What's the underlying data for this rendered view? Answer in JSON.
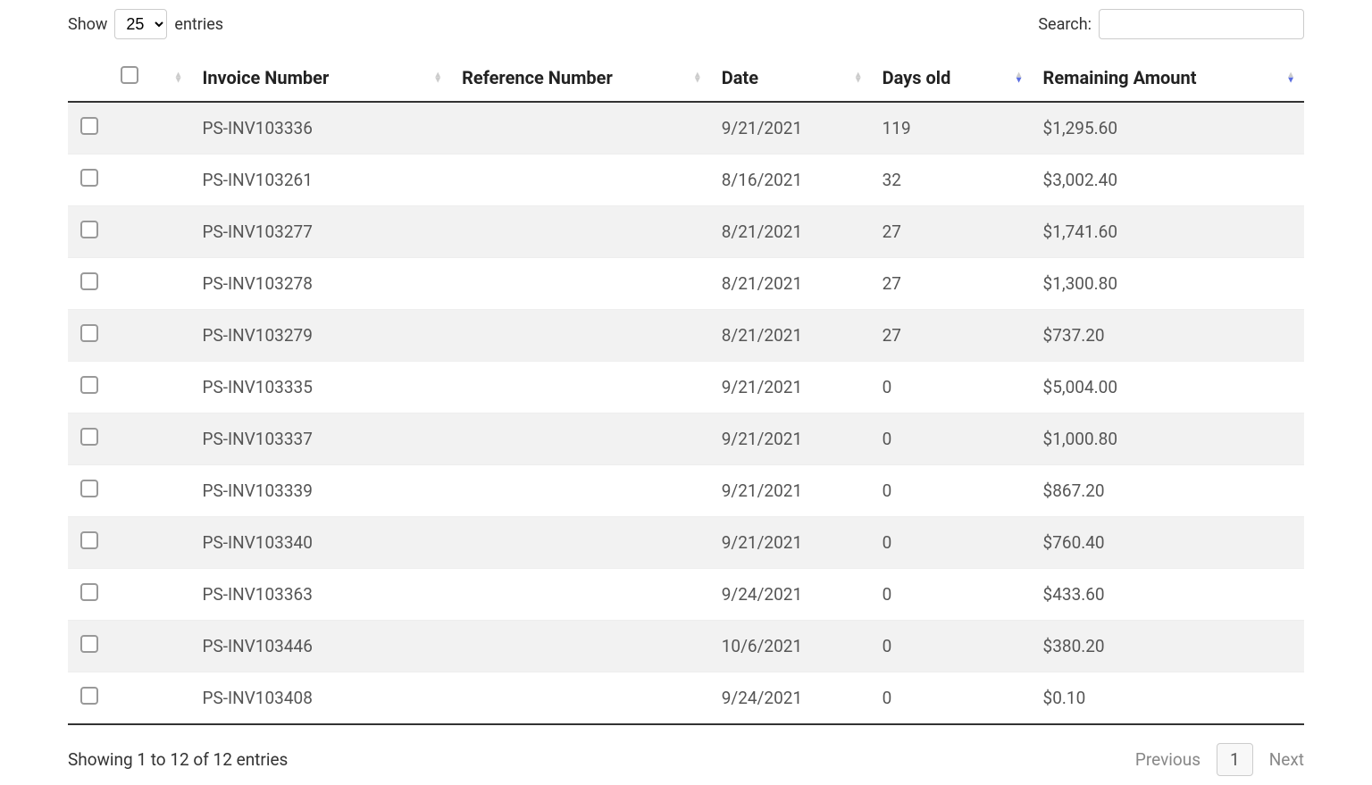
{
  "controls": {
    "show_label": "Show",
    "entries_label": "entries",
    "page_size": "25",
    "search_label": "Search:",
    "search_value": ""
  },
  "columns": {
    "invoice": "Invoice Number",
    "reference": "Reference Number",
    "date": "Date",
    "days_old": "Days old",
    "remaining": "Remaining Amount"
  },
  "rows": [
    {
      "invoice": "PS-INV103336",
      "reference": "",
      "date": "9/21/2021",
      "days_old": "119",
      "remaining": "$1,295.60"
    },
    {
      "invoice": "PS-INV103261",
      "reference": "",
      "date": "8/16/2021",
      "days_old": "32",
      "remaining": "$3,002.40"
    },
    {
      "invoice": "PS-INV103277",
      "reference": "",
      "date": "8/21/2021",
      "days_old": "27",
      "remaining": "$1,741.60"
    },
    {
      "invoice": "PS-INV103278",
      "reference": "",
      "date": "8/21/2021",
      "days_old": "27",
      "remaining": "$1,300.80"
    },
    {
      "invoice": "PS-INV103279",
      "reference": "",
      "date": "8/21/2021",
      "days_old": "27",
      "remaining": "$737.20"
    },
    {
      "invoice": "PS-INV103335",
      "reference": "",
      "date": "9/21/2021",
      "days_old": "0",
      "remaining": "$5,004.00"
    },
    {
      "invoice": "PS-INV103337",
      "reference": "",
      "date": "9/21/2021",
      "days_old": "0",
      "remaining": "$1,000.80"
    },
    {
      "invoice": "PS-INV103339",
      "reference": "",
      "date": "9/21/2021",
      "days_old": "0",
      "remaining": "$867.20"
    },
    {
      "invoice": "PS-INV103340",
      "reference": "",
      "date": "9/21/2021",
      "days_old": "0",
      "remaining": "$760.40"
    },
    {
      "invoice": "PS-INV103363",
      "reference": "",
      "date": "9/24/2021",
      "days_old": "0",
      "remaining": "$433.60"
    },
    {
      "invoice": "PS-INV103446",
      "reference": "",
      "date": "10/6/2021",
      "days_old": "0",
      "remaining": "$380.20"
    },
    {
      "invoice": "PS-INV103408",
      "reference": "",
      "date": "9/24/2021",
      "days_old": "0",
      "remaining": "$0.10"
    }
  ],
  "footer": {
    "info": "Showing 1 to 12 of 12 entries",
    "prev": "Previous",
    "next": "Next",
    "current_page": "1"
  }
}
